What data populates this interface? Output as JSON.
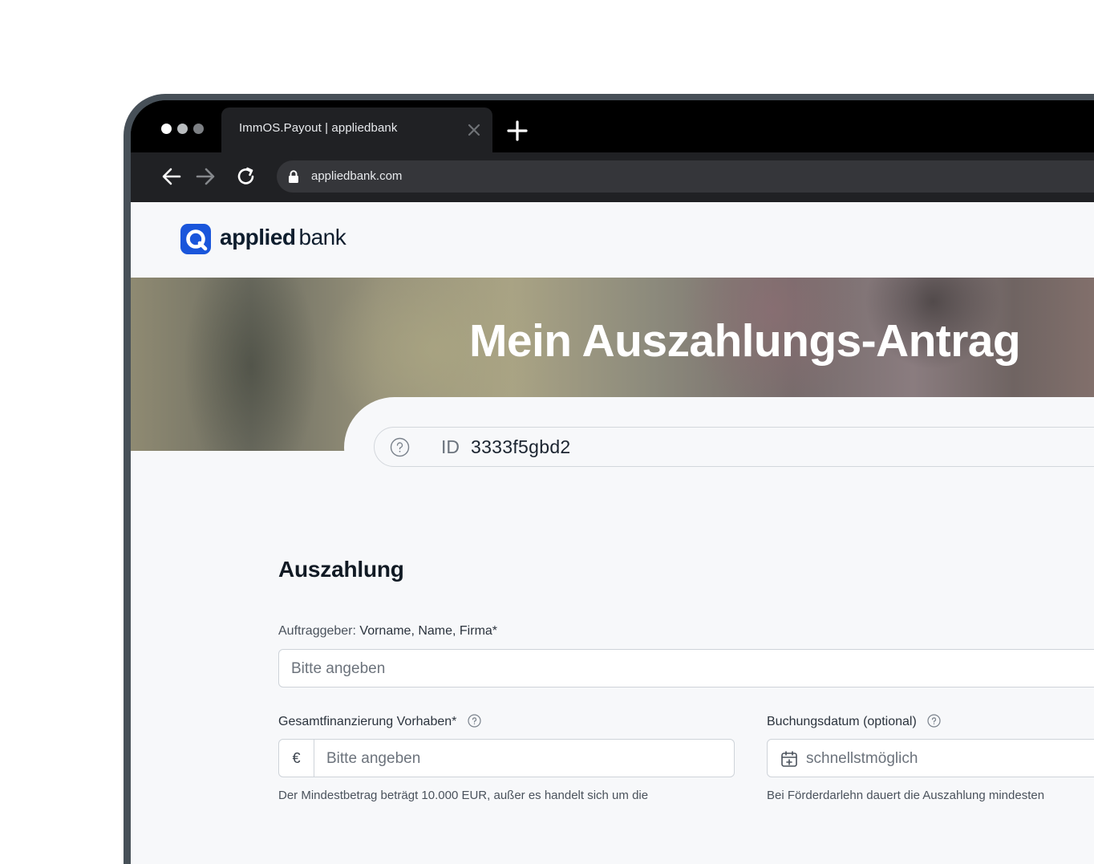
{
  "browser": {
    "tab_title": "ImmOS.Payout | appliedbank",
    "url": "appliedbank.com"
  },
  "brand": {
    "name_bold": "applied",
    "name_light": "bank",
    "accent_color": "#1a56db"
  },
  "hero": {
    "title": "Mein Auszahlungs-Antrag"
  },
  "id_bar": {
    "label": "ID",
    "value": "3333f5gbd2"
  },
  "form": {
    "section_title": "Auszahlung",
    "auftraggeber": {
      "label_prefix": "Auftraggeber:",
      "label_main": "Vorname, Name, Firma*",
      "placeholder": "Bitte angeben"
    },
    "gesamtfinanzierung": {
      "label": "Gesamtfinanzierung Vorhaben*",
      "currency": "€",
      "placeholder": "Bitte angeben",
      "hint": "Der Mindestbetrag beträgt 10.000 EUR, außer es handelt sich um die"
    },
    "buchungsdatum": {
      "label": "Buchungsdatum (optional)",
      "placeholder": "schnellstmöglich",
      "hint": "Bei Förderdarlehn dauert die Auszahlung mindesten"
    }
  }
}
